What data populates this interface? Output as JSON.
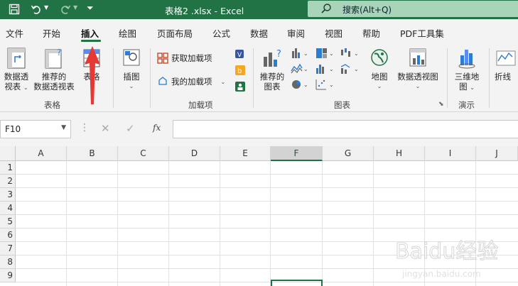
{
  "titlebar": {
    "doc_title": "表格2 .xlsx  -  Excel",
    "search_placeholder": "搜索(Alt+Q)"
  },
  "tabs": [
    {
      "label": "文件"
    },
    {
      "label": "开始"
    },
    {
      "label": "插入"
    },
    {
      "label": "绘图"
    },
    {
      "label": "页面布局"
    },
    {
      "label": "公式"
    },
    {
      "label": "数据"
    },
    {
      "label": "审阅"
    },
    {
      "label": "视图"
    },
    {
      "label": "帮助"
    },
    {
      "label": "PDF工具集"
    }
  ],
  "active_tab": "插入",
  "ribbon": {
    "tables": {
      "pivot_line1": "数据透",
      "pivot_line2": "视表",
      "recpivot_line1": "推荐的",
      "recpivot_line2": "数据透视表",
      "table": "表格",
      "group": "表格"
    },
    "illustrations": {
      "label": "插图"
    },
    "addins": {
      "get": "获取加载项",
      "mine": "我的加载项",
      "group": "加载项"
    },
    "charts": {
      "rec_line1": "推荐的",
      "rec_line2": "图表",
      "map": "地图",
      "pivotchart": "数据透视图",
      "group": "图表"
    },
    "tours": {
      "map3d_line1": "三维地",
      "map3d_line2": "图",
      "group": "演示"
    },
    "sparklines": {
      "line": "折线"
    }
  },
  "formula_bar": {
    "name_box": "F10",
    "fx": "fx",
    "value": ""
  },
  "grid": {
    "columns": [
      "A",
      "B",
      "C",
      "D",
      "E",
      "F",
      "G",
      "H",
      "I",
      "J"
    ],
    "rows": [
      "1",
      "2",
      "3",
      "4",
      "5",
      "6",
      "7",
      "8",
      "9"
    ],
    "selected_column": "F",
    "selected_cell": "F10"
  },
  "watermark": {
    "brand": "Baidu经验",
    "url": "jingyan.baidu.com"
  },
  "colors": {
    "accent": "#217346",
    "annotation": "#e53935"
  }
}
